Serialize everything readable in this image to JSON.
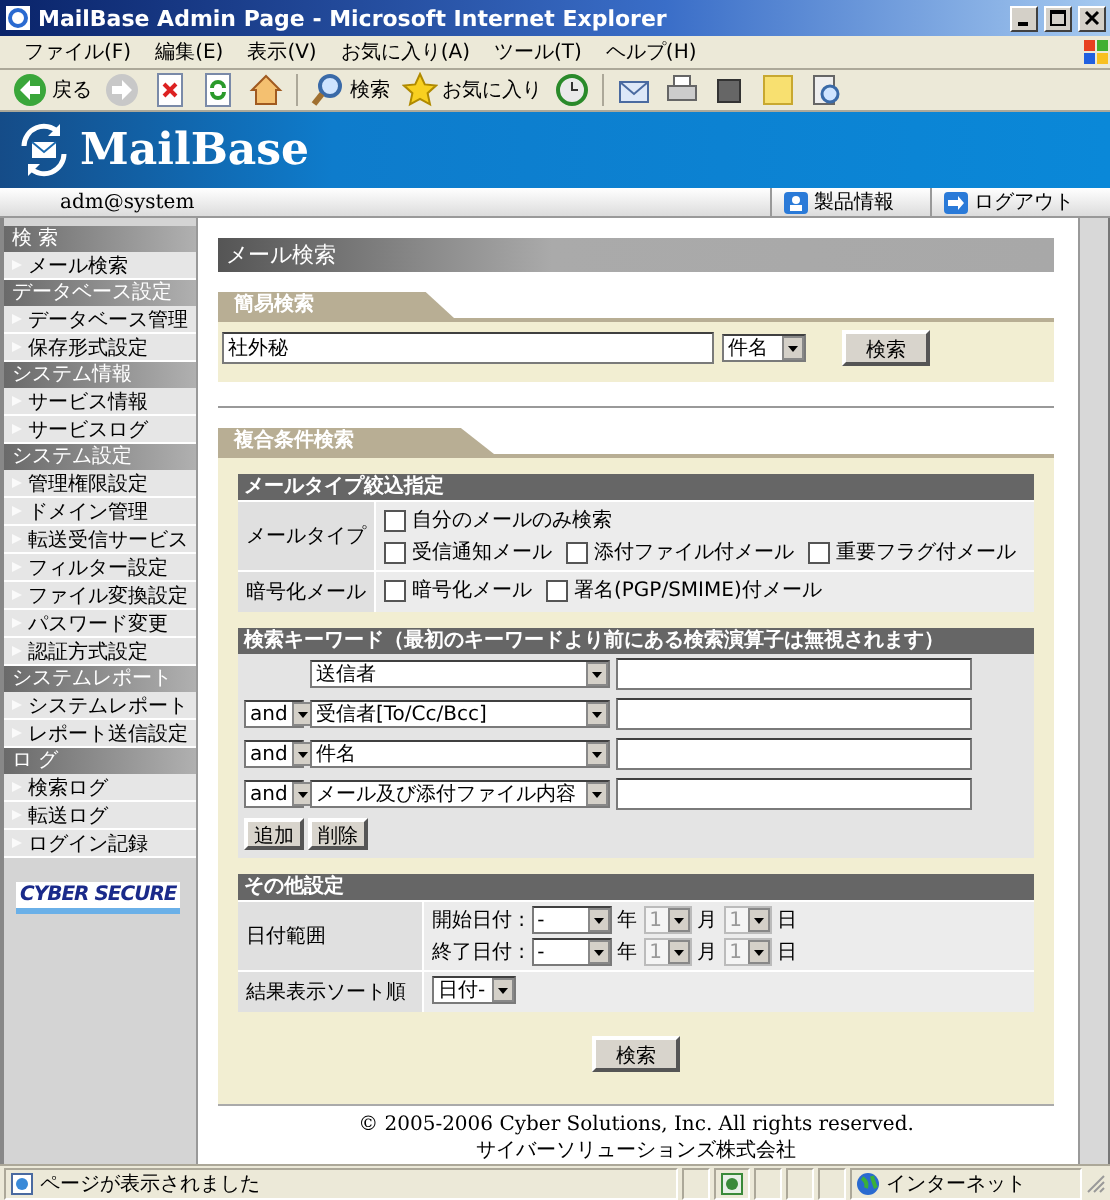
{
  "window": {
    "title": "MailBase Admin Page - Microsoft Internet Explorer"
  },
  "menu": [
    "ファイル(F)",
    "編集(E)",
    "表示(V)",
    "お気に入り(A)",
    "ツール(T)",
    "ヘルプ(H)"
  ],
  "toolbar": [
    {
      "kind": "back",
      "label": "戻る"
    },
    {
      "kind": "forward"
    },
    {
      "kind": "stop"
    },
    {
      "kind": "refresh"
    },
    {
      "kind": "home"
    },
    {
      "kind": "search",
      "label": "検索"
    },
    {
      "kind": "favorites",
      "label": "お気に入り"
    },
    {
      "kind": "history"
    },
    {
      "kind": "mail"
    },
    {
      "kind": "print"
    },
    {
      "kind": "edit"
    },
    {
      "kind": "note"
    },
    {
      "kind": "research"
    }
  ],
  "header": {
    "logo": "MailBase",
    "user": "adm@system",
    "links": [
      {
        "kind": "info",
        "label": "製品情報"
      },
      {
        "kind": "logout",
        "label": "ログアウト"
      }
    ]
  },
  "sidebar": {
    "groups": [
      {
        "title": "検 索",
        "items": [
          "メール検索"
        ]
      },
      {
        "title": "データベース設定",
        "items": [
          "データベース管理",
          "保存形式設定"
        ]
      },
      {
        "title": "システム情報",
        "items": [
          "サービス情報",
          "サービスログ"
        ]
      },
      {
        "title": "システム設定",
        "items": [
          "管理権限設定",
          "ドメイン管理",
          "転送受信サービス",
          "フィルター設定",
          "ファイル変換設定",
          "パスワード変更",
          "認証方式設定"
        ]
      },
      {
        "title": "システムレポート",
        "items": [
          "システムレポート",
          "レポート送信設定"
        ]
      },
      {
        "title": "ロ グ",
        "items": [
          "検索ログ",
          "転送ログ",
          "ログイン記録"
        ]
      }
    ],
    "badge": "CYBER SECURE"
  },
  "content": {
    "title": "メール検索",
    "simple_search": {
      "title": "簡易検索",
      "query": "社外秘",
      "field": "件名",
      "button": "検索"
    },
    "advanced": {
      "title": "複合条件検索",
      "mail_type": {
        "title": "メールタイプ絞込指定",
        "rows": [
          {
            "label": "メールタイプ",
            "lines": [
              [
                {
                  "label": "自分のメールのみ検索",
                  "checked": false
                }
              ],
              [
                {
                  "label": "受信通知メール",
                  "checked": false
                },
                {
                  "label": "添付ファイル付メール",
                  "checked": false
                },
                {
                  "label": "重要フラグ付メール",
                  "checked": false
                }
              ]
            ]
          },
          {
            "label": "暗号化メール",
            "lines": [
              [
                {
                  "label": "暗号化メール",
                  "checked": false
                },
                {
                  "label": "署名(PGP/SMIME)付メール",
                  "checked": false
                }
              ]
            ]
          }
        ]
      },
      "keywords": {
        "title": "検索キーワード（最初のキーワードより前にある検索演算子は無視されます）",
        "rows": [
          {
            "field": "送信者"
          },
          {
            "operator": "and",
            "field": "受信者[To/Cc/Bcc]"
          },
          {
            "operator": "and",
            "field": "件名"
          },
          {
            "operator": "and",
            "field": "メール及び添付ファイル内容"
          }
        ],
        "buttons": [
          "追加",
          "削除"
        ]
      },
      "other": {
        "title": "その他設定",
        "date_range": {
          "label": "日付範囲",
          "rows": [
            {
              "label": "開始日付 :",
              "fields": [
                {
                  "value": "-",
                  "unit": "年",
                  "disabled": false
                },
                {
                  "value": "1",
                  "unit": "月",
                  "disabled": true
                },
                {
                  "value": "1",
                  "unit": "日",
                  "disabled": true
                }
              ]
            },
            {
              "label": "終了日付 :",
              "fields": [
                {
                  "value": "-",
                  "unit": "年",
                  "disabled": false
                },
                {
                  "value": "1",
                  "unit": "月",
                  "disabled": true
                },
                {
                  "value": "1",
                  "unit": "日",
                  "disabled": true
                }
              ]
            }
          ]
        },
        "sort": {
          "label": "結果表示ソート順",
          "value": "日付-"
        }
      },
      "button": "検索"
    },
    "footer": {
      "copyright": "© 2005-2006 Cyber Solutions, Inc. All rights reserved.",
      "company": "サイバーソリューションズ株式会社"
    }
  },
  "status_bar": {
    "text": "ページが表示されました",
    "zone": "インターネット"
  }
}
